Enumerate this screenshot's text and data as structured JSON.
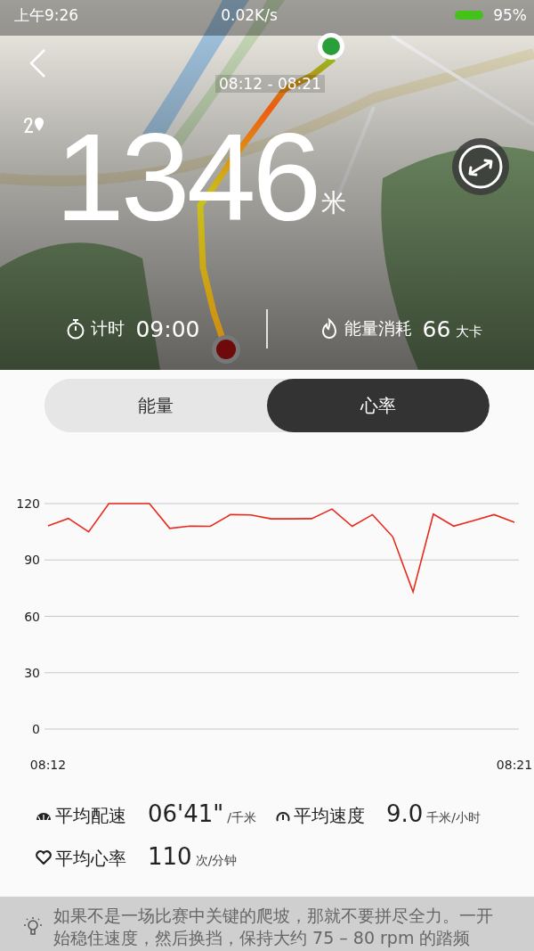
{
  "status_bar": {
    "time": "上午9:26",
    "network_speed": "0.02K/s",
    "battery": "95%"
  },
  "map": {
    "route_time": "08:12 - 08:21",
    "distance": "1346",
    "distance_unit": "米",
    "stats": [
      {
        "kind": "timer",
        "label": "计时",
        "value": "09:00"
      },
      {
        "kind": "energy",
        "label": "能量消耗",
        "value": "66",
        "unit": "大卡"
      }
    ]
  },
  "tabs": [
    {
      "label": "能量",
      "selected": false
    },
    {
      "label": "心率",
      "selected": true
    }
  ],
  "chart_data": {
    "type": "line",
    "categories": [
      "08:12",
      null,
      null,
      null,
      null,
      null,
      null,
      null,
      null,
      null,
      null,
      null,
      null,
      null,
      null,
      null,
      null,
      null,
      null,
      null,
      null,
      null,
      null,
      "08:21"
    ],
    "ylim": [
      0,
      120
    ],
    "yticks": [
      0,
      30,
      60,
      90,
      120
    ],
    "grid": true,
    "series": [
      {
        "color": "#e8291c",
        "values": [
          108.2,
          112.1,
          105,
          120,
          120,
          120,
          106.8,
          108,
          107.9,
          114.1,
          114,
          111.9,
          111.9,
          112,
          117.1,
          107.9,
          114.1,
          102.3,
          73,
          114.4,
          108,
          111,
          114.1,
          110
        ]
      }
    ]
  },
  "summary": [
    {
      "kind": "pace",
      "label": "平均配速",
      "value": "06'41\"",
      "unit": "/千米"
    },
    {
      "kind": "speed",
      "label": "平均速度",
      "value": "9.0",
      "unit": "千米/小时"
    },
    {
      "kind": "heart",
      "label": "平均心率",
      "value": "110",
      "unit": "次/分钟"
    }
  ],
  "tip": "如果不是一场比赛中关键的爬坡，那就不要拼尽全力。一开始稳住速度，然后换挡，保持大约 75 – 80 rpm 的踏频"
}
